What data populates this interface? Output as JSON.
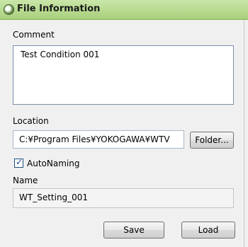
{
  "window": {
    "title": "File Information"
  },
  "comment": {
    "label": "Comment",
    "value": "Test Condition 001"
  },
  "location": {
    "label": "Location",
    "value": "C:¥Program Files¥YOKOGAWA¥WTV",
    "folder_button": "Folder..."
  },
  "auto_naming": {
    "label": "AutoNaming",
    "checked": true,
    "mark": "✓"
  },
  "name": {
    "label": "Name",
    "value": "WT_Setting_001"
  },
  "actions": {
    "save": "Save",
    "load": "Load"
  }
}
